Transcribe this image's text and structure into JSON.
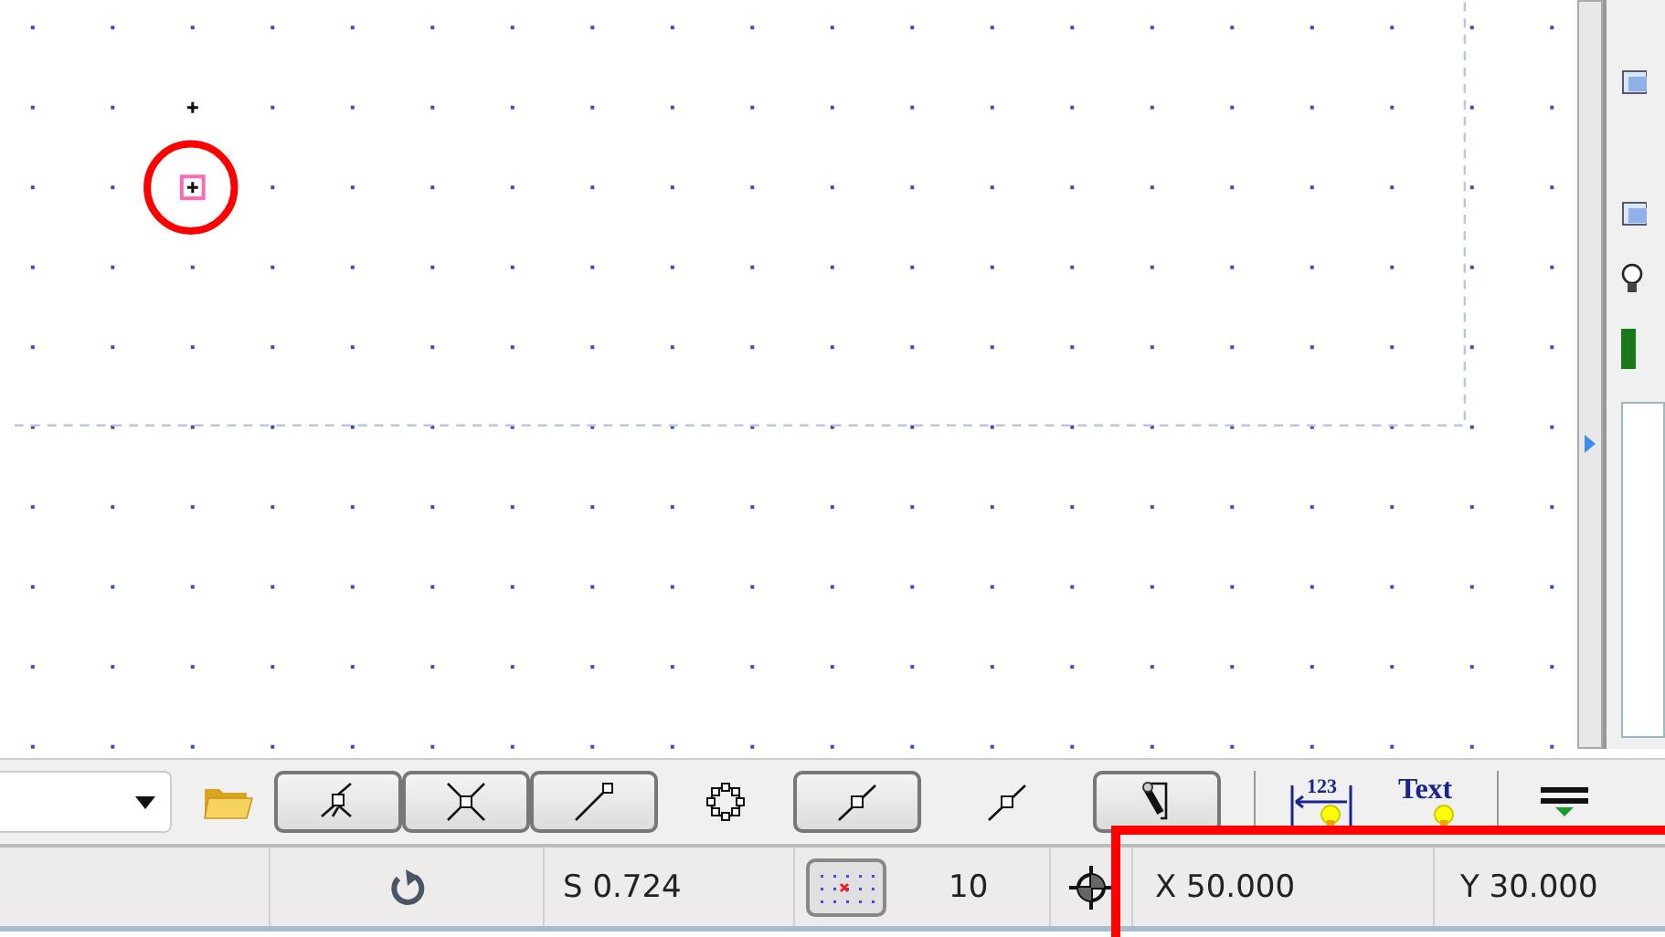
{
  "toolbar": {
    "dropdown": {
      "expanded": false
    },
    "tools": [
      {
        "kind": "folder",
        "selected": false
      },
      {
        "kind": "angle",
        "selected": true
      },
      {
        "kind": "cross",
        "selected": true
      },
      {
        "kind": "endpoint",
        "selected": true
      },
      {
        "kind": "nodes",
        "selected": false
      },
      {
        "kind": "midpoint",
        "selected": true
      },
      {
        "kind": "midpoint",
        "selected": false
      },
      {
        "kind": "pen",
        "selected": true
      },
      {
        "kind": "separator"
      },
      {
        "kind": "dimension",
        "label": "123",
        "selected": false
      },
      {
        "kind": "text",
        "label": "Text",
        "selected": false
      },
      {
        "kind": "separator"
      },
      {
        "kind": "lineweight",
        "selected": false
      }
    ]
  },
  "status_bar": {
    "scale": "S 0.724",
    "grid_toggle": {
      "selected": true
    },
    "grid_size": "10",
    "x": "X 50.000",
    "y": "Y 30.000"
  }
}
